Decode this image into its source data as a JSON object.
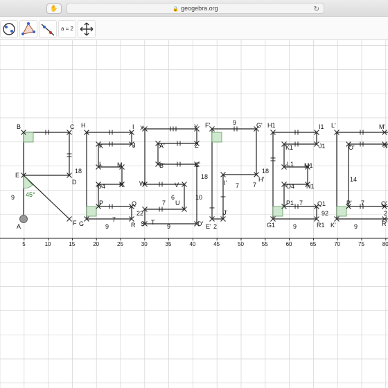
{
  "browser": {
    "url": "geogebra.org",
    "extension_icon": "✋",
    "reload_icon": "↻",
    "lock_icon": "lock-icon"
  },
  "toolbar": {
    "tools": [
      {
        "name": "move-graphics-circle-tool",
        "icon": "circle-with-points-icon"
      },
      {
        "name": "triangle-polygon-tool",
        "icon": "triangle-icon"
      },
      {
        "name": "line-tool",
        "icon": "line-with-points-icon"
      },
      {
        "name": "slider-tool",
        "label": "a = 2"
      },
      {
        "name": "move-view-tool",
        "icon": "move-arrows-icon"
      }
    ]
  },
  "axis": {
    "x_ticks": [
      "5",
      "10",
      "15",
      "20",
      "25",
      "30",
      "35",
      "40",
      "45",
      "50",
      "55",
      "60",
      "65",
      "70",
      "75",
      "80"
    ]
  },
  "point_labels": [
    "B",
    "C",
    "H",
    "I",
    "X",
    "Y",
    "F'",
    "G'",
    "H1",
    "I1",
    "L'",
    "M'",
    "E",
    "D",
    "K",
    "J",
    "A'",
    "Z",
    "K1",
    "J1",
    "O'",
    "N'",
    "L",
    "M",
    "B'",
    "C'",
    "W",
    "V",
    "I'",
    "H'",
    "L1",
    "M1",
    "O4",
    "N",
    "O4",
    "N1",
    "P",
    "Q",
    "P1",
    "Q1",
    "P'",
    "Q'",
    "A",
    "F",
    "G",
    "R",
    "S",
    "T",
    "U",
    "D'",
    "E'",
    "J'",
    "G1",
    "R1",
    "K'",
    "R'"
  ],
  "measures": [
    "9",
    "18",
    "45°",
    "2",
    "2",
    "9",
    "7",
    "7",
    "9",
    "9",
    "6",
    "10",
    "18",
    "7",
    "2",
    "7",
    "18",
    "9",
    "9",
    "7",
    "14",
    "7",
    "9",
    "2",
    "2"
  ],
  "colors": {
    "grid": "#d3d3d3",
    "angle_fill": "#cfe8cf",
    "angle_stroke": "#5e9b5e",
    "angle_text": "#2e7d2e",
    "point": "#333333",
    "lines": "#222222"
  }
}
